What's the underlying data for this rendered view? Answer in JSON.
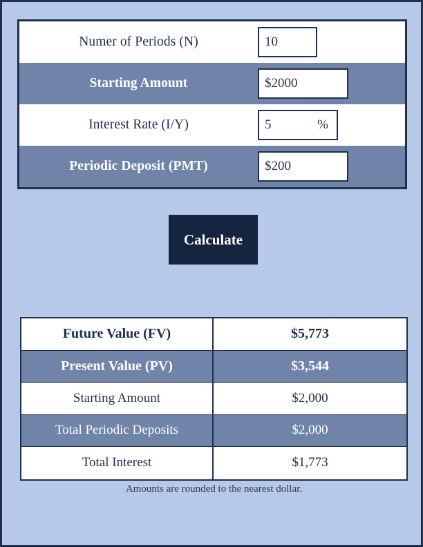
{
  "inputs": {
    "rows": [
      {
        "label": "Numer of Periods (N)",
        "value": "10",
        "suffix": "",
        "box": "w-periods"
      },
      {
        "label": "Starting Amount",
        "value": "$2000",
        "suffix": "",
        "box": "w-amount"
      },
      {
        "label": "Interest Rate (I/Y)",
        "value": "5",
        "suffix": "%",
        "box": "w-rate"
      },
      {
        "label": "Periodic Deposit (PMT)",
        "value": "$200",
        "suffix": "",
        "box": "w-pmt"
      }
    ]
  },
  "actions": {
    "calculate_label": "Calculate"
  },
  "results": {
    "rows": [
      {
        "label": "Future Value (FV)",
        "value": "$5,773"
      },
      {
        "label": "Present Value (PV)",
        "value": "$3,544"
      },
      {
        "label": "Starting Amount",
        "value": "$2,000"
      },
      {
        "label": "Total Periodic Deposits",
        "value": "$2,000"
      },
      {
        "label": "Total Interest",
        "value": "$1,773"
      }
    ]
  },
  "footnote": {
    "text": "Amounts are rounded to the nearest dollar."
  },
  "colors": {
    "page_background": "#b6c9e8",
    "border": "#1f2f4d",
    "stripe": "#6f84a8",
    "button_background": "#152540",
    "button_text": "#ffffff"
  }
}
